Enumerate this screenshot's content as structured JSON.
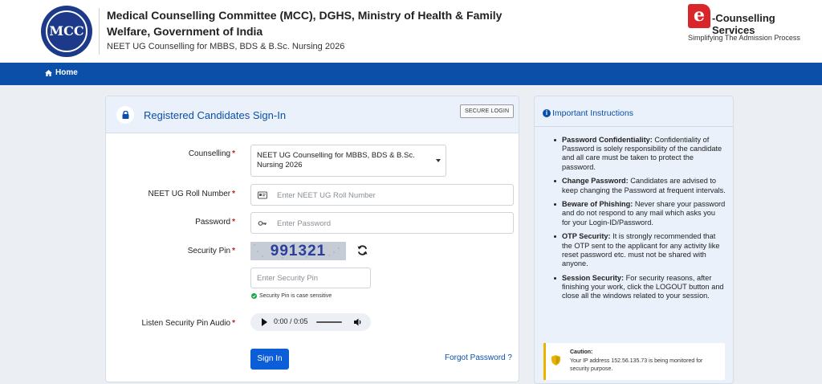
{
  "header": {
    "logo_text": "MCC",
    "title": "Medical Counselling Committee (MCC), DGHS, Ministry of Health & Family Welfare, Government of India",
    "subtitle": "NEET UG Counselling for MBBS, BDS & B.Sc. Nursing 2026",
    "brand_name": "-Counselling Services",
    "brand_tagline": "Simplifying The Admission Process"
  },
  "nav": {
    "home_label": "Home"
  },
  "signin": {
    "title": "Registered Candidates Sign-In",
    "secure_badge": "SECURE LOGIN",
    "counselling_label": "Counselling",
    "counselling_value": "NEET UG Counselling for MBBS, BDS & B.Sc. Nursing 2026",
    "roll_label": "NEET UG Roll Number",
    "roll_placeholder": "Enter NEET UG Roll Number",
    "password_label": "Password",
    "password_placeholder": "Enter Password",
    "pin_label": "Security Pin",
    "captcha_digits": "991321",
    "pin_placeholder": "Enter Security Pin",
    "pin_hint": "Security Pin is case sensitive",
    "audio_label": "Listen Security Pin Audio",
    "audio_time": "0:00 / 0:05",
    "signin_button": "Sign In",
    "forgot_link": "Forgot Password ?",
    "required_mark": "*"
  },
  "instructions": {
    "title": "Important Instructions",
    "items": [
      {
        "head": "Password Confidentiality:",
        "body": " Confidentiality of Password is solely responsibility of the candidate and all care must be taken to protect the password."
      },
      {
        "head": "Change Password:",
        "body": " Candidates are advised to keep changing the Password at frequent intervals."
      },
      {
        "head": "Beware of Phishing:",
        "body": " Never share your password and do not respond to any mail which asks you for your Login-ID/Password."
      },
      {
        "head": "OTP Security:",
        "body": " It is strongly recommended that the OTP sent to the applicant for any activity like reset password etc. must not be shared with anyone."
      },
      {
        "head": "Session Security:",
        "body": " For security reasons, after finishing your work, click the LOGOUT button and close all the windows related to your session."
      }
    ],
    "caution_title": "Caution:",
    "caution_body": "Your IP address 152.56.135.73 is being monitored for security purpose."
  },
  "colors": {
    "nav": "#0b4fa8",
    "primary_button": "#0b5ed7",
    "required": "#c81e1e",
    "panel_bg": "#eaf1fb",
    "caution_border": "#e8b400"
  },
  "icons": [
    "home-icon",
    "lock-icon",
    "id-card-icon",
    "key-icon",
    "refresh-icon",
    "check-circle-icon",
    "play-icon",
    "volume-icon",
    "info-icon",
    "shield-icon",
    "chevron-down-icon"
  ]
}
